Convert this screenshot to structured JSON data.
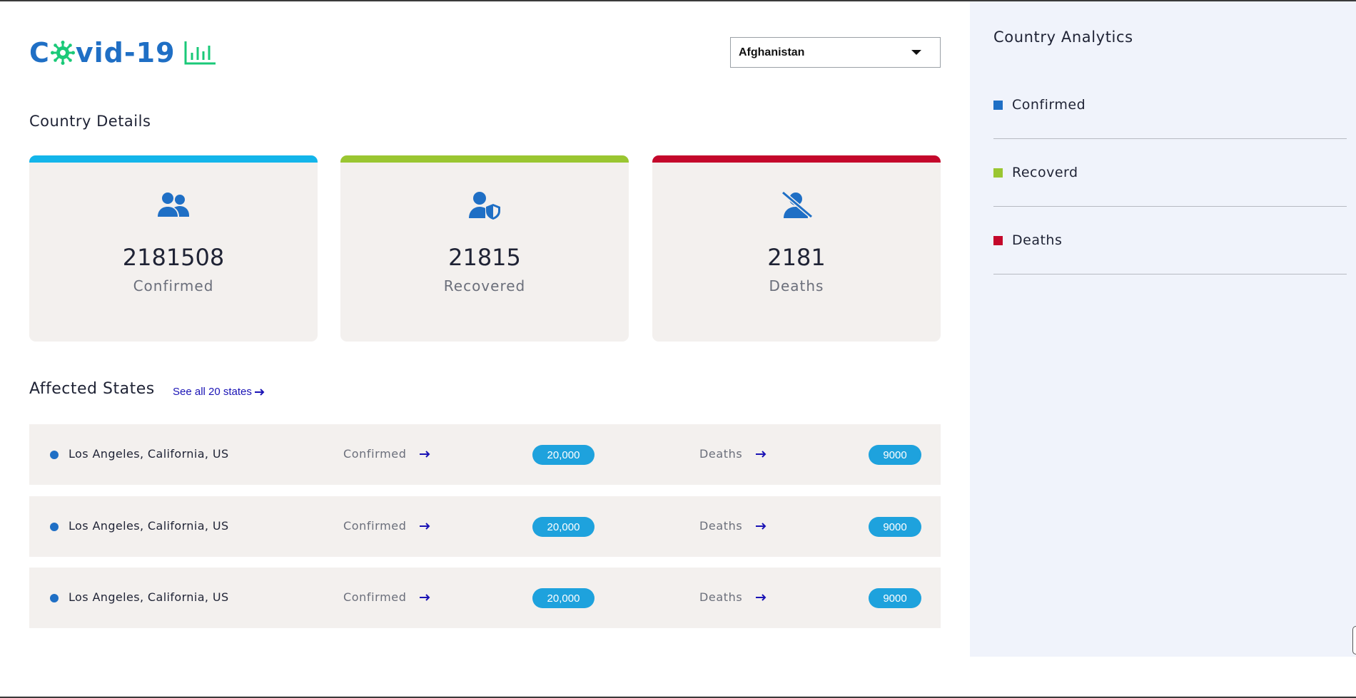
{
  "brand": {
    "logo_text_prefix": "C",
    "logo_text_suffix": "vid-19",
    "logo_color": "#1f6fc5",
    "accent_green": "#1ac978"
  },
  "country_select": {
    "selected": "Afghanistan"
  },
  "country_details": {
    "title": "Country Details",
    "cards": [
      {
        "value": "2181508",
        "label": "Confirmed",
        "bar_color": "#13b5ea",
        "icon": "users-icon"
      },
      {
        "value": "21815",
        "label": "Recovered",
        "bar_color": "#9ac631",
        "icon": "user-shield-icon"
      },
      {
        "value": "2181",
        "label": "Deaths",
        "bar_color": "#c4072b",
        "icon": "user-slash-icon"
      }
    ]
  },
  "affected_states": {
    "title": "Affected States",
    "see_all": "See all 20 states",
    "rows": [
      {
        "name": "Los Angeles, California, US",
        "confirmed_label": "Confirmed",
        "confirmed": "20,000",
        "deaths_label": "Deaths",
        "deaths": "9000"
      },
      {
        "name": "Los Angeles, California, US",
        "confirmed_label": "Confirmed",
        "confirmed": "20,000",
        "deaths_label": "Deaths",
        "deaths": "9000"
      },
      {
        "name": "Los Angeles, California, US",
        "confirmed_label": "Confirmed",
        "confirmed": "20,000",
        "deaths_label": "Deaths",
        "deaths": "9000"
      }
    ]
  },
  "analytics": {
    "title": "Country Analytics",
    "legend": [
      {
        "label": "Confirmed",
        "color": "#1f6fc5"
      },
      {
        "label": "Recoverd",
        "color": "#9ac631"
      },
      {
        "label": "Deaths",
        "color": "#c4072b"
      }
    ]
  }
}
